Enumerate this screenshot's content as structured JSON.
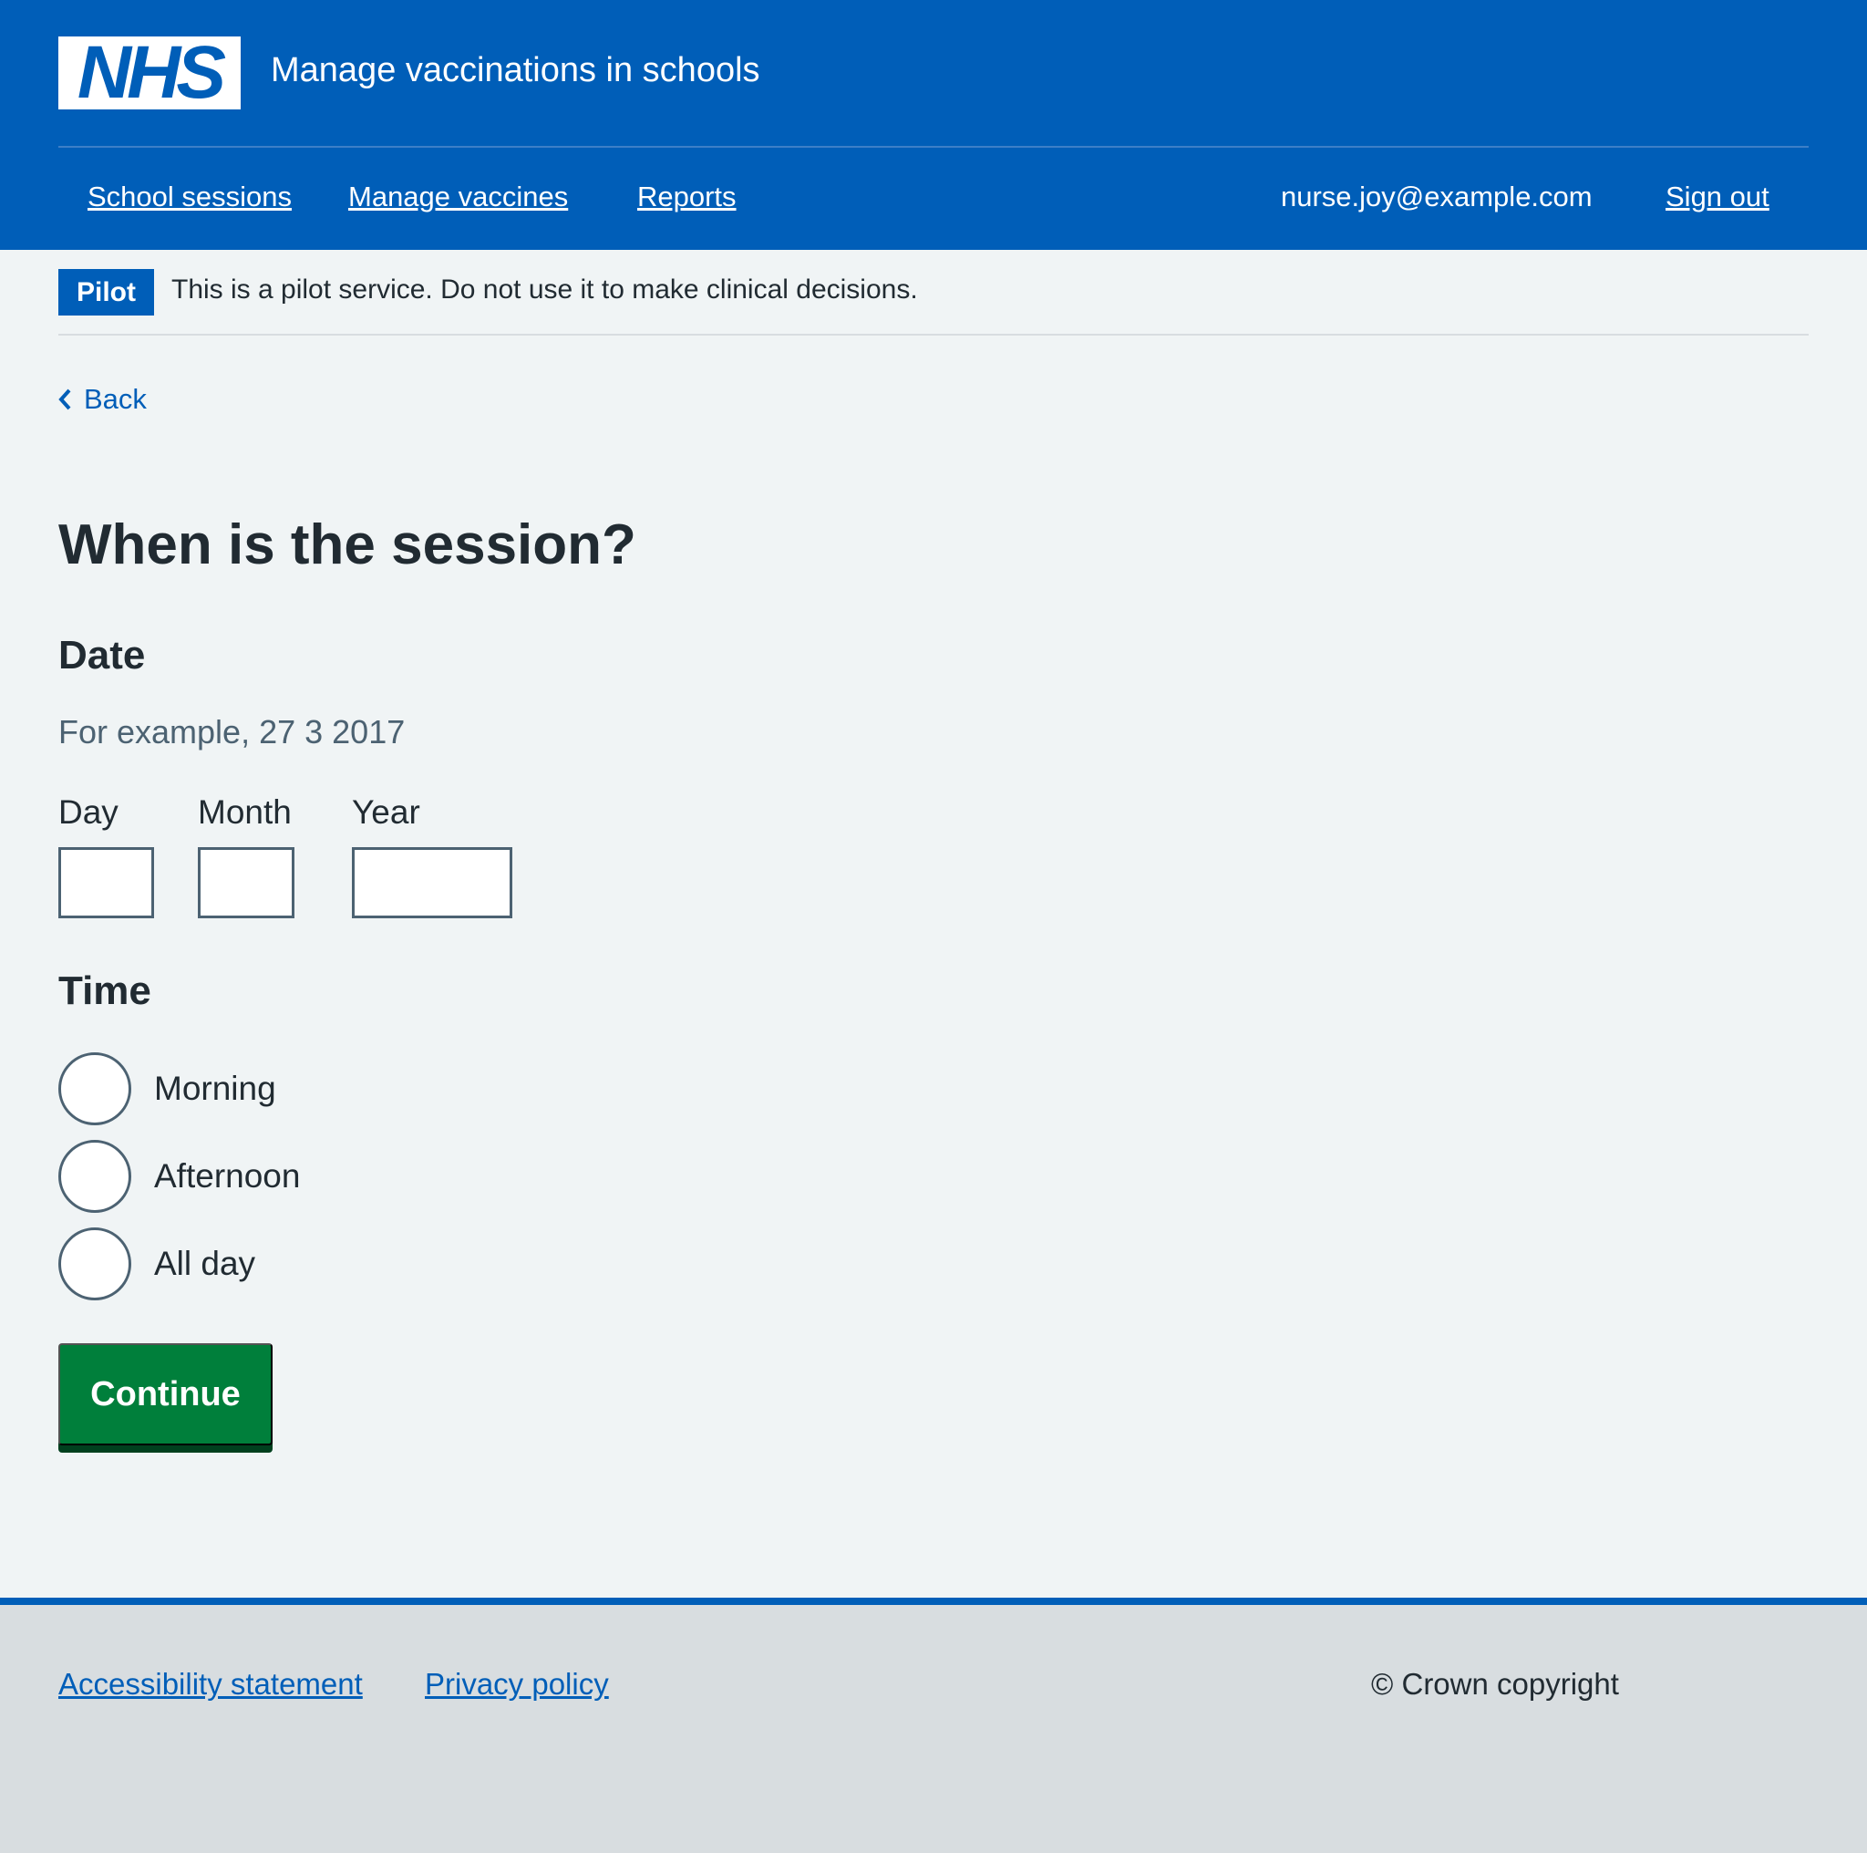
{
  "header": {
    "logo_text": "NHS",
    "service_name": "Manage vaccinations in schools",
    "nav": [
      "School sessions",
      "Manage vaccines",
      "Reports"
    ],
    "user_email": "nurse.joy@example.com",
    "sign_out": "Sign out"
  },
  "banner": {
    "tag": "Pilot",
    "text": "This is a pilot service. Do not use it to make clinical decisions."
  },
  "back_link": "Back",
  "page_title": "When is the session?",
  "date": {
    "legend": "Date",
    "hint": "For example, 27 3 2017",
    "day_label": "Day",
    "day_value": "",
    "month_label": "Month",
    "month_value": "",
    "year_label": "Year",
    "year_value": ""
  },
  "time": {
    "legend": "Time",
    "options": [
      "Morning",
      "Afternoon",
      "All day"
    ],
    "selected": null
  },
  "continue_label": "Continue",
  "footer": {
    "links": [
      "Accessibility statement",
      "Privacy policy"
    ],
    "copyright": "© Crown copyright"
  },
  "colors": {
    "brand": "#005eb8",
    "button": "#007f3b",
    "background": "#f0f4f5",
    "footer": "#d8dde0"
  }
}
